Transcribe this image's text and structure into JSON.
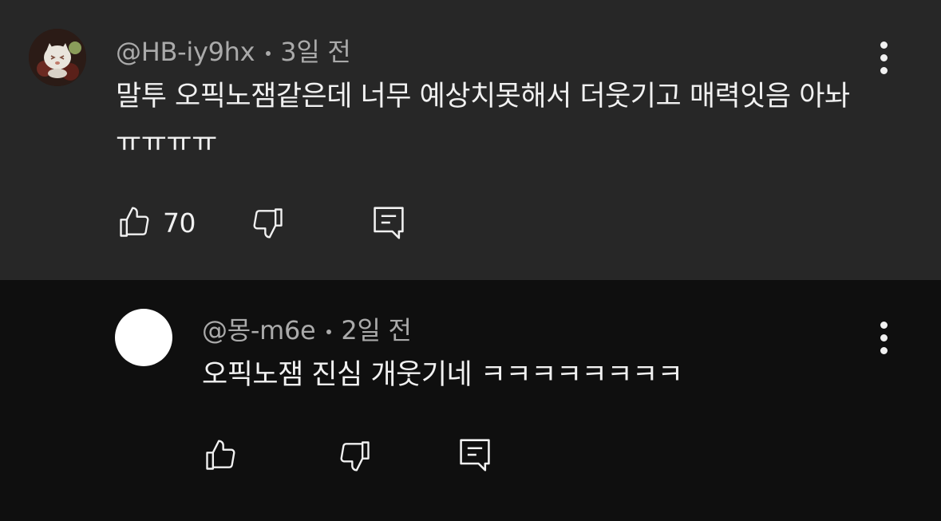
{
  "comments": [
    {
      "author": "@HB-iy9hx",
      "time": "3일 전",
      "text": "말투 오픽노잼같은데 너무 예상치못해서 더웃기고 매력잇음 아놔 ㅠㅠㅠㅠ",
      "like_count": "70",
      "avatar": "avatar-image"
    },
    {
      "author": "@몽-m6e",
      "time": "2일 전",
      "text": "오픽노잼 진심 개웃기네 ㅋㅋㅋㅋㅋㅋㅋㅋ",
      "like_count": "",
      "avatar": "blank-avatar"
    }
  ],
  "icons": {
    "like": "thumbs-up-icon",
    "dislike": "thumbs-down-icon",
    "reply": "reply-icon",
    "more": "more-vertical-icon"
  },
  "colors": {
    "top_comment_bg": "#272727",
    "reply_bg": "#0f0f0f",
    "text": "#f1f1f1",
    "meta": "#aaaaaa"
  }
}
